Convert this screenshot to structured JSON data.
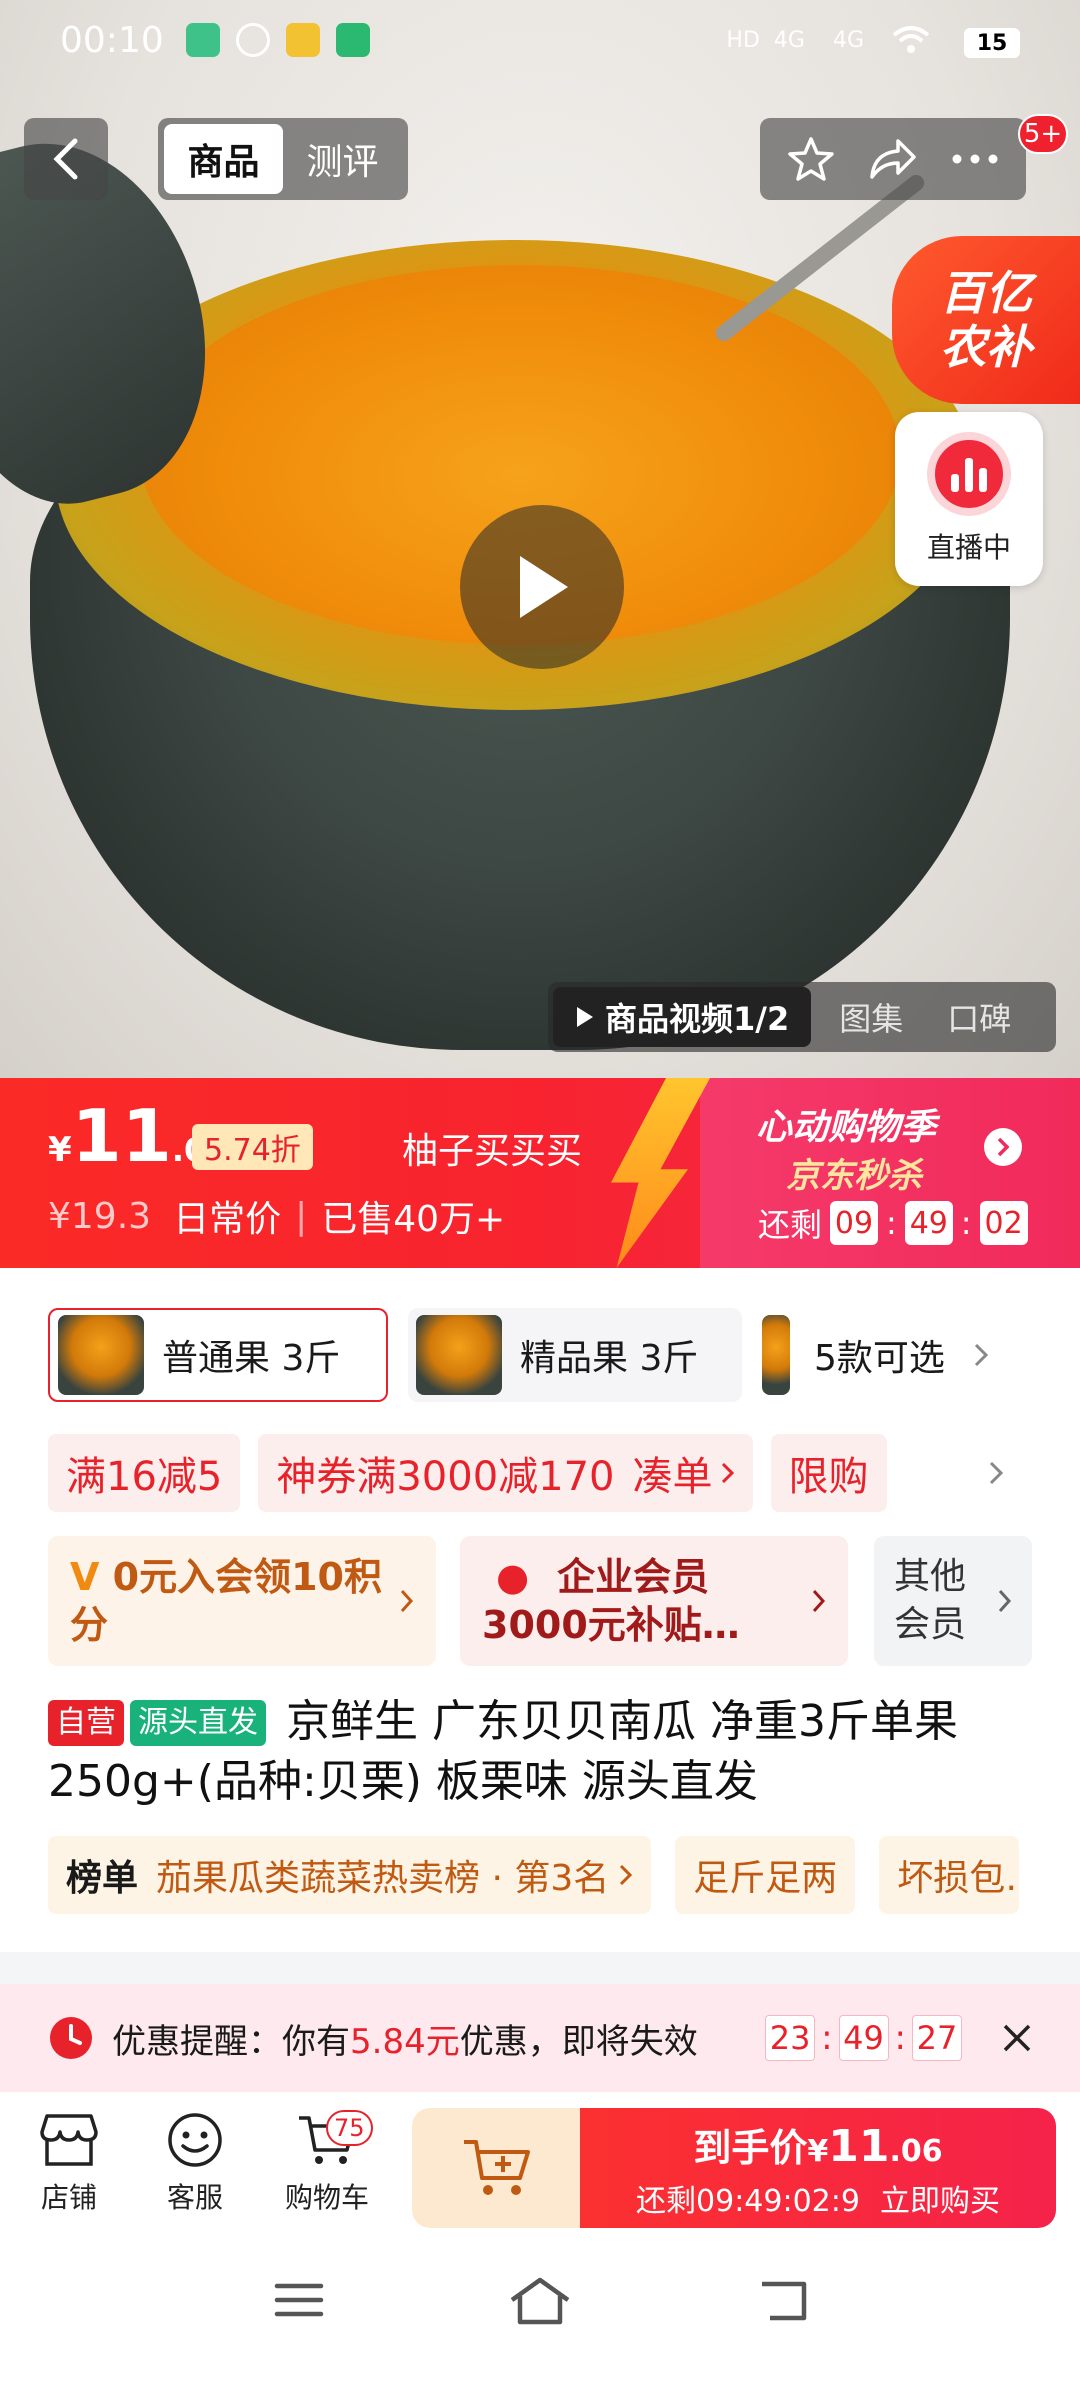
{
  "status_bar": {
    "time": "00:10",
    "battery": "15",
    "network_1": "4G",
    "network_2": "4G"
  },
  "nav": {
    "tabs": [
      {
        "label": "商品"
      },
      {
        "label": "测评"
      }
    ],
    "badge": "5+"
  },
  "banner": {
    "line1": "百亿",
    "line2": "农补"
  },
  "live": {
    "label": "直播中"
  },
  "media": {
    "video": "商品视频1/2",
    "gallery": "图集",
    "reviews": "口碑"
  },
  "price": {
    "symbol": "¥",
    "int": "11",
    "dec": ".06",
    "discount": "5.74折",
    "seller": "柚子买买买",
    "orig": "¥19.3",
    "orig_label": "日常价",
    "sold": "已售40万+",
    "promo_title": "心动购物季",
    "promo_sub": "京东秒杀",
    "countdown_label": "还剩",
    "countdown": [
      "09",
      "49",
      "02"
    ]
  },
  "variants": [
    {
      "label": "普通果 3斤"
    },
    {
      "label": "精品果 3斤"
    },
    {
      "label": "5款可选"
    }
  ],
  "coupons": [
    {
      "label": "满16减5"
    },
    {
      "label": "神券满3000减170",
      "action": "凑单"
    },
    {
      "label": "限购"
    }
  ],
  "cards": [
    {
      "text": "0元入会领10积分"
    },
    {
      "line1": "企业会员",
      "line2": "3000元补贴…"
    },
    {
      "line1": "其他",
      "line2": "会员"
    }
  ],
  "product": {
    "tag1": "自营",
    "tag2": "源头直发",
    "title": "京鲜生 广东贝贝南瓜 净重3斤单果250g+(品种:贝栗) 板栗味 源头直发"
  },
  "ranks": [
    {
      "label": "榜单",
      "text": "茄果瓜类蔬菜热卖榜 · 第3名"
    },
    {
      "text": "足斤足两"
    },
    {
      "text": "坏损包…"
    }
  ],
  "reminder": {
    "prefix": "优惠提醒：你有",
    "amount": "5.84元",
    "suffix": "优惠，即将失效",
    "countdown": [
      "23",
      "49",
      "27"
    ]
  },
  "bottom": {
    "store": "店铺",
    "service": "客服",
    "cart": "购物车",
    "cart_count": "75",
    "buy_price_label": "到手价",
    "buy_price_symbol": "¥",
    "buy_price_int": "11",
    "buy_price_dec": ".06",
    "buy_countdown": "还剩09:49:02:9",
    "buy_action": "立即购买"
  },
  "colors": {
    "accent": "#f0212e",
    "promo": "#f12a5a",
    "gold": "#ffd27a"
  }
}
